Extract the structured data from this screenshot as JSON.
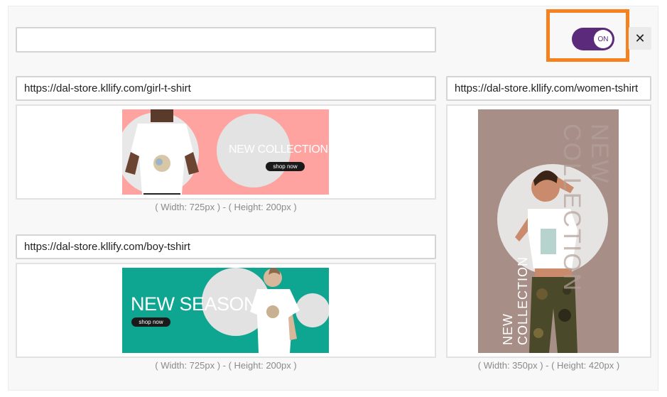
{
  "header": {
    "title_input_value": "",
    "toggle_label": "ON",
    "close_symbol": "✕"
  },
  "items": [
    {
      "url": "https://dal-store.kllify.com/girl-t-shirt",
      "caption": "( Width: 725px ) - ( Height: 200px )",
      "banner": {
        "headline": "NEW COLLECTION",
        "cta": "shop now"
      }
    },
    {
      "url": "https://dal-store.kllify.com/women-tshirt",
      "caption": "( Width: 350px ) - ( Height: 420px )",
      "banner": {
        "headline": "NEW COLLECTION",
        "watermark": "NEW COLLECTION"
      }
    },
    {
      "url": "https://dal-store.kllify.com/boy-tshirt",
      "caption": "( Width: 725px ) - ( Height: 200px )",
      "banner": {
        "headline": "NEW SEASON",
        "cta": "shop now"
      }
    }
  ],
  "colors": {
    "toggle_on": "#5b2a7a",
    "highlight": "#f5821f",
    "banner_pink": "#ffa3a0",
    "banner_teal": "#0ea591",
    "banner_mauve": "#a78f88"
  }
}
